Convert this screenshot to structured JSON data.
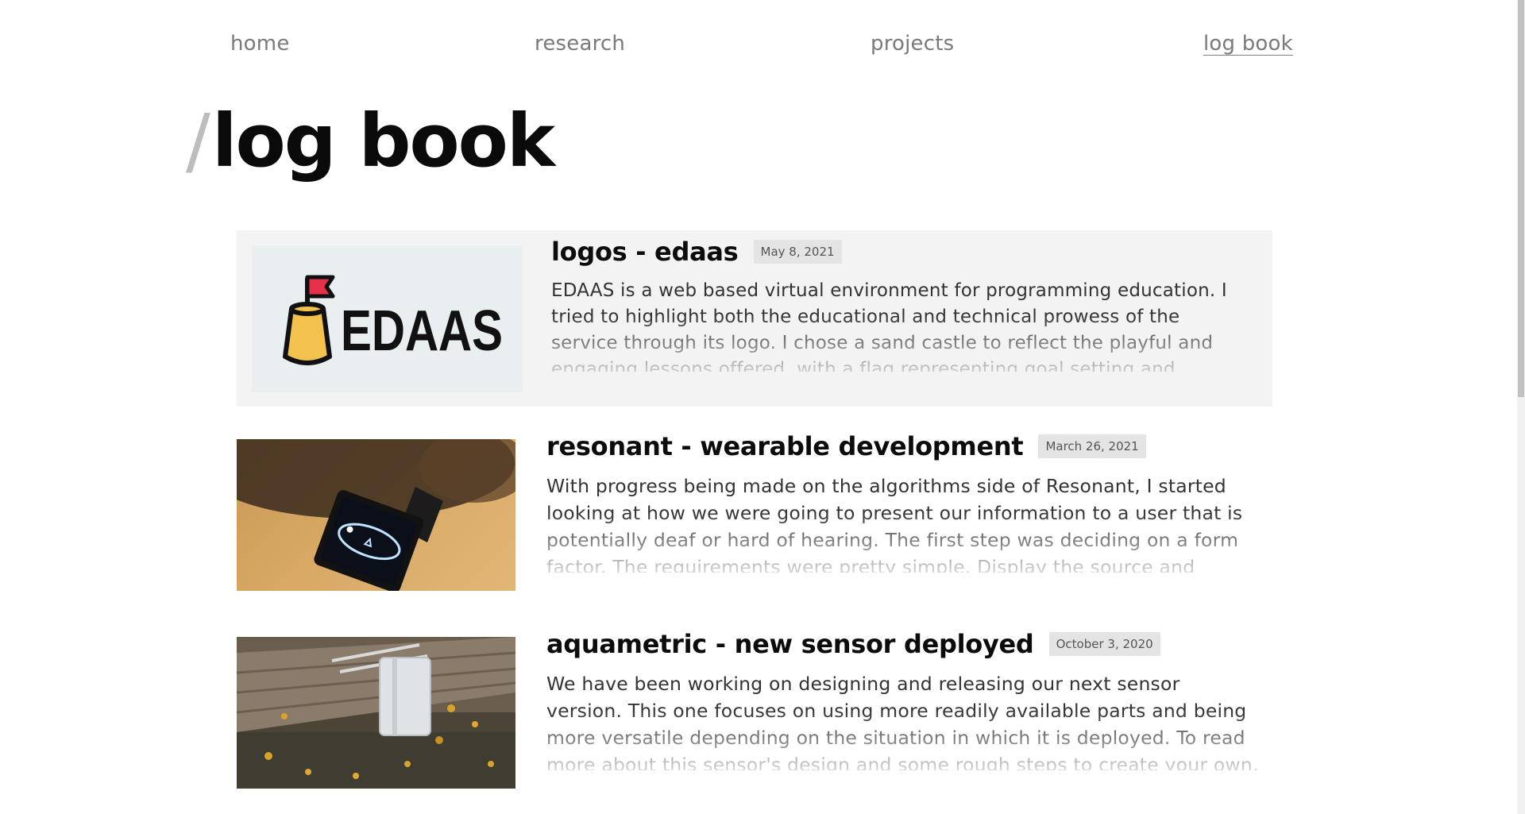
{
  "nav": {
    "items": [
      {
        "label": "home"
      },
      {
        "label": "research"
      },
      {
        "label": "projects"
      },
      {
        "label": "log book",
        "active": true
      }
    ]
  },
  "page": {
    "slash": "/",
    "title": "log book"
  },
  "entries": [
    {
      "title": "logos - edaas",
      "date": "May 8, 2021",
      "excerpt": "EDAAS is a web based virtual environment for programming education. I tried to highlight both the educational and technical prowess of the service through its logo. I chose a sand castle to reflect the playful and engaging lessons offered, with a flag representing goal setting and",
      "image": "edaas-logo",
      "image_text": "EDAAS"
    },
    {
      "title": "resonant - wearable development",
      "date": "March 26, 2021",
      "excerpt": "With progress being made on the algorithms side of Resonant, I started looking at how we were going to present our information to a user that is potentially deaf or hard of hearing. The first step was deciding on a form factor. The requirements were pretty simple. Display the source and",
      "image": "wearable-device-photo"
    },
    {
      "title": "aquametric - new sensor deployed",
      "date": "October 3, 2020",
      "excerpt": "We have been working on designing and releasing our next sensor version. This one focuses on using more readily available parts and being more versatile depending on the situation in which it is deployed. To read more about this sensor's design and some rough steps to create your own, visit",
      "image": "sensor-deployment-photo"
    }
  ],
  "colors": {
    "nav_text": "#7a7a7a",
    "slash": "#bdbdbd",
    "highlight_bg": "#f3f3f3",
    "date_bg": "#e4e4e4",
    "edaas_logo_bg": "#e9eef0",
    "castle_yellow": "#f2c14e",
    "flag_red": "#e5304a"
  }
}
